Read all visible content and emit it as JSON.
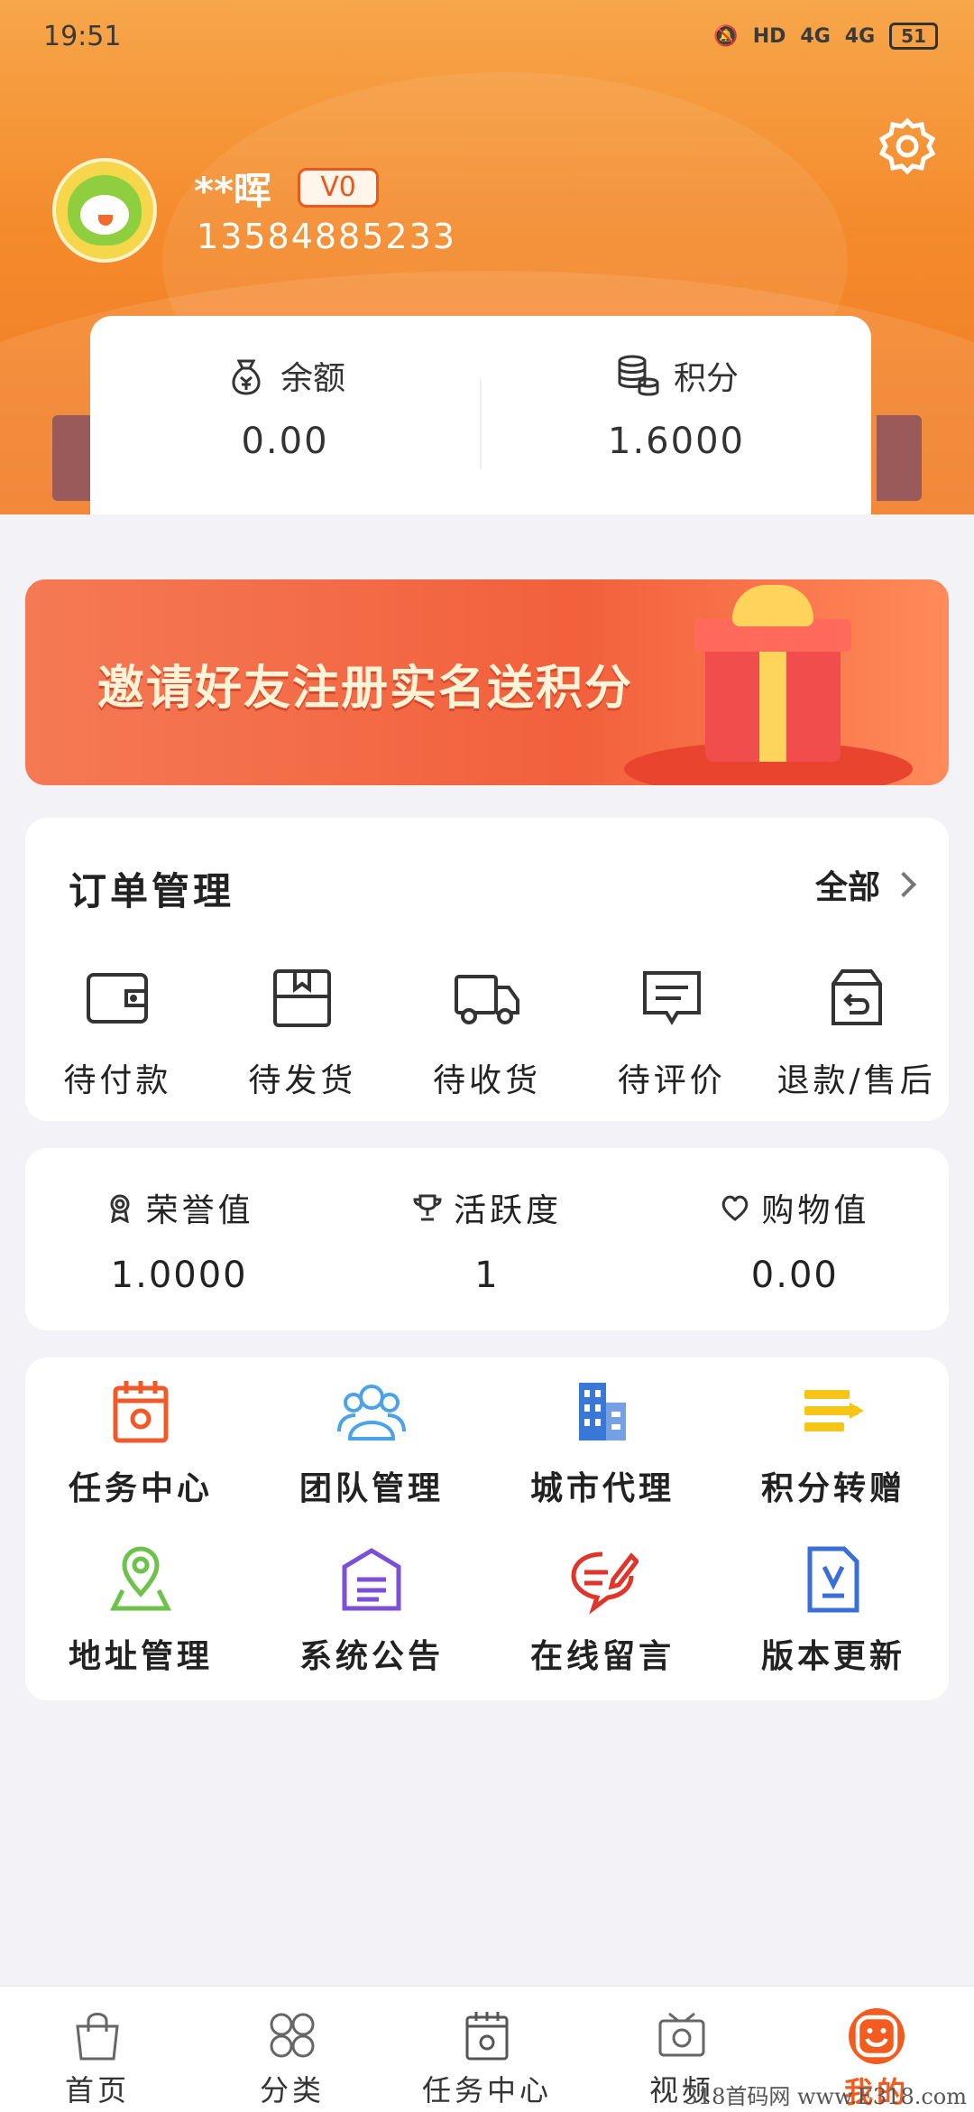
{
  "status_bar": {
    "time": "19:51",
    "network_1": "4G",
    "network_2": "4G",
    "hd": "HD",
    "battery": "51"
  },
  "profile": {
    "username": "**晖",
    "level": "V0",
    "phone": "13584885233"
  },
  "balance": [
    {
      "label": "余额",
      "value": "0.00",
      "icon": "money-bag-icon"
    },
    {
      "label": "积分",
      "value": "1.6000",
      "icon": "coins-stack-icon"
    }
  ],
  "banner": {
    "text": "邀请好友注册实名送积分"
  },
  "orders": {
    "title": "订单管理",
    "all_label": "全部",
    "items": [
      {
        "label": "待付款",
        "icon": "wallet-icon"
      },
      {
        "label": "待发货",
        "icon": "box-icon"
      },
      {
        "label": "待收货",
        "icon": "truck-icon"
      },
      {
        "label": "待评价",
        "icon": "comment-icon"
      },
      {
        "label": "退款/售后",
        "icon": "return-icon"
      }
    ]
  },
  "stats": [
    {
      "label": "荣誉值",
      "value": "1.0000",
      "icon": "medal-icon"
    },
    {
      "label": "活跃度",
      "value": "1",
      "icon": "trophy-icon"
    },
    {
      "label": "购物值",
      "value": "0.00",
      "icon": "heart-icon"
    }
  ],
  "services": [
    {
      "label": "任务中心",
      "icon": "task-calendar-icon",
      "color": "#f05a28"
    },
    {
      "label": "团队管理",
      "icon": "team-icon",
      "color": "#4aa3e8"
    },
    {
      "label": "城市代理",
      "icon": "building-icon",
      "color": "#3a78d8"
    },
    {
      "label": "积分转赠",
      "icon": "transfer-icon",
      "color": "#f5c518"
    },
    {
      "label": "地址管理",
      "icon": "location-icon",
      "color": "#6cc24a"
    },
    {
      "label": "系统公告",
      "icon": "notice-icon",
      "color": "#7b4fd6"
    },
    {
      "label": "在线留言",
      "icon": "message-icon",
      "color": "#e0352b"
    },
    {
      "label": "版本更新",
      "icon": "document-icon",
      "color": "#3a6fd8"
    }
  ],
  "bottom_nav": [
    {
      "label": "首页",
      "icon": "shopping-bag-icon"
    },
    {
      "label": "分类",
      "icon": "grid-icon"
    },
    {
      "label": "任务中心",
      "icon": "task-calendar-icon"
    },
    {
      "label": "视频",
      "icon": "video-icon"
    },
    {
      "label": "我的",
      "icon": "smile-icon",
      "active": true
    }
  ],
  "watermark": "318首码网 www.E318.com",
  "colors": {
    "brand_orange": "#f48a2c",
    "active_red": "#f35b1f"
  }
}
